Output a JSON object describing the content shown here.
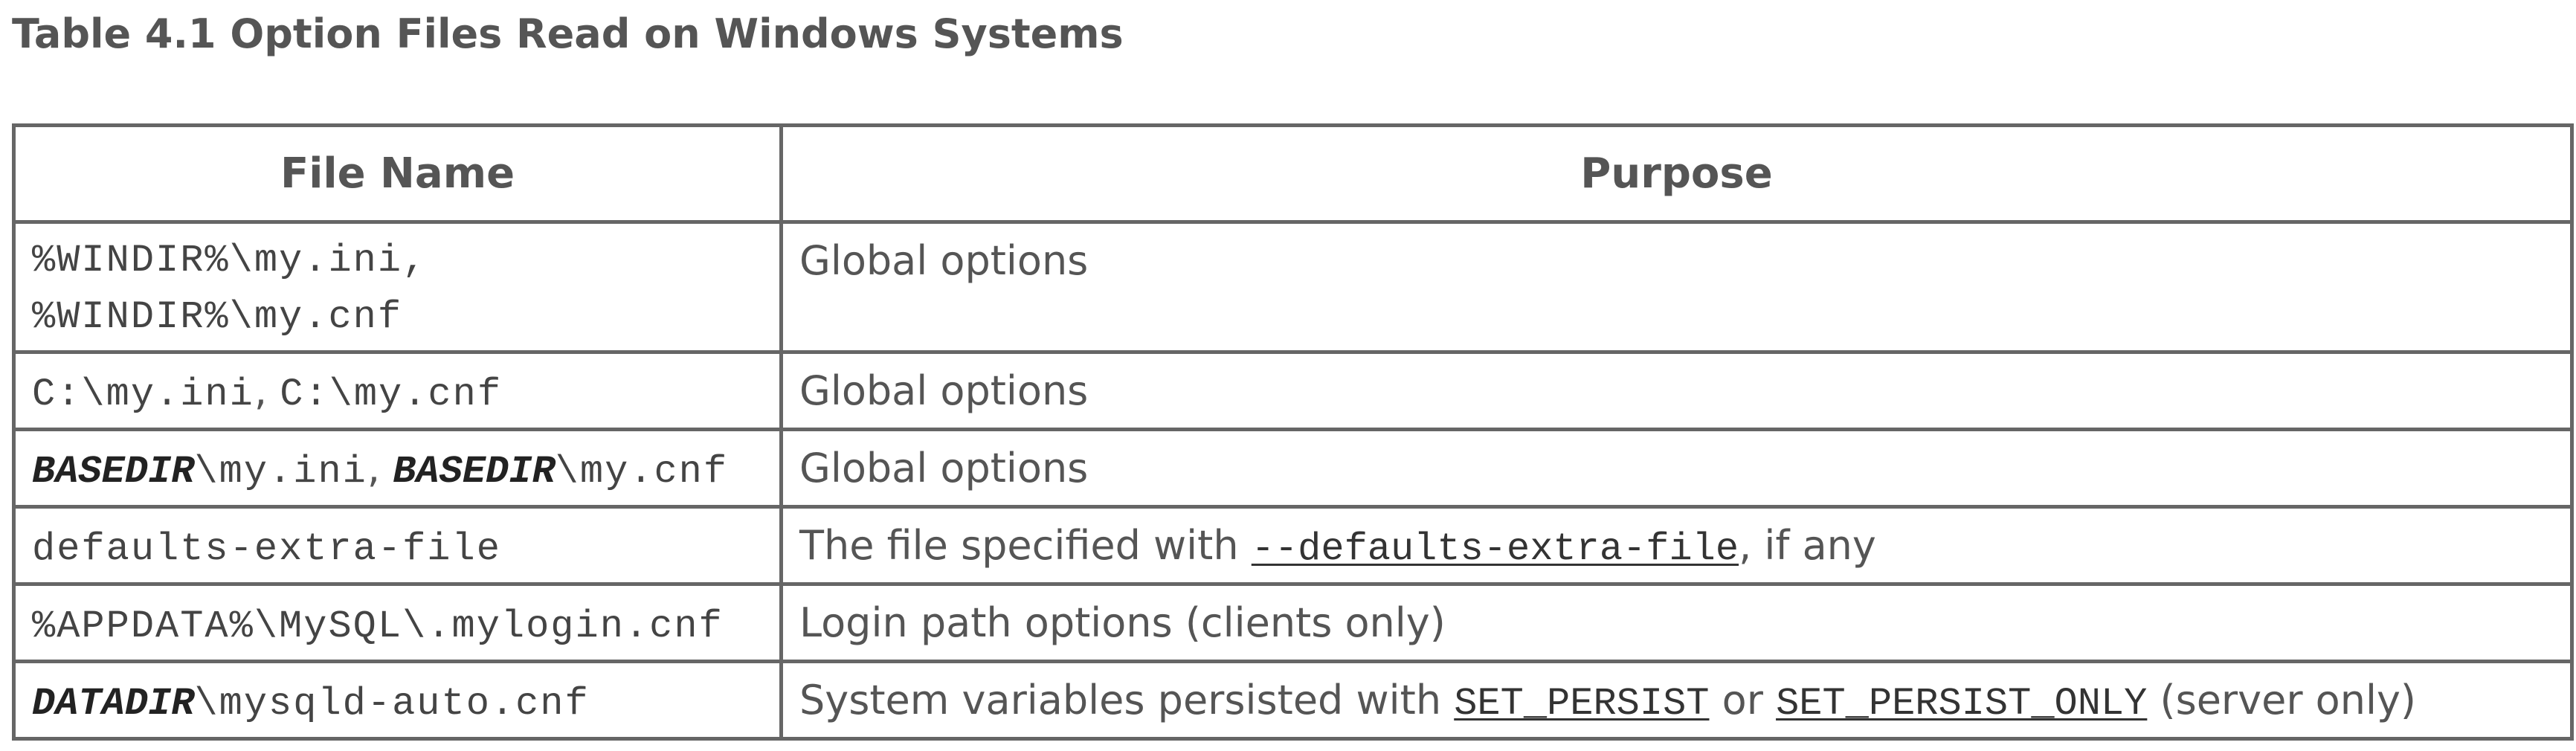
{
  "caption": "Table 4.1 Option Files Read on Windows Systems",
  "headers": {
    "file_name": "File Name",
    "purpose": "Purpose"
  },
  "rows": [
    {
      "file_line1": "%WINDIR%\\my.ini,",
      "file_line2": "%WINDIR%\\my.cnf",
      "purpose": "Global options"
    },
    {
      "file_a": "C:\\my.ini",
      "sep": ", ",
      "file_b": "C:\\my.cnf",
      "purpose": "Global options"
    },
    {
      "var_a": "BASEDIR",
      "file_a": "\\my.ini",
      "sep": ", ",
      "var_b": "BASEDIR",
      "file_b": "\\my.cnf",
      "purpose": "Global options"
    },
    {
      "file": "defaults-extra-file",
      "purpose_pre": "The file specified with ",
      "purpose_link": "--defaults-extra-file",
      "purpose_post": ", if any"
    },
    {
      "file": "%APPDATA%\\MySQL\\.mylogin.cnf",
      "purpose": "Login path options (clients only)"
    },
    {
      "var": "DATADIR",
      "file": "\\mysqld-auto.cnf",
      "purpose_pre": "System variables persisted with ",
      "link_a": "SET_PERSIST",
      "mid": " or ",
      "link_b": "SET_PERSIST_ONLY",
      "purpose_post": " (server only)"
    }
  ]
}
